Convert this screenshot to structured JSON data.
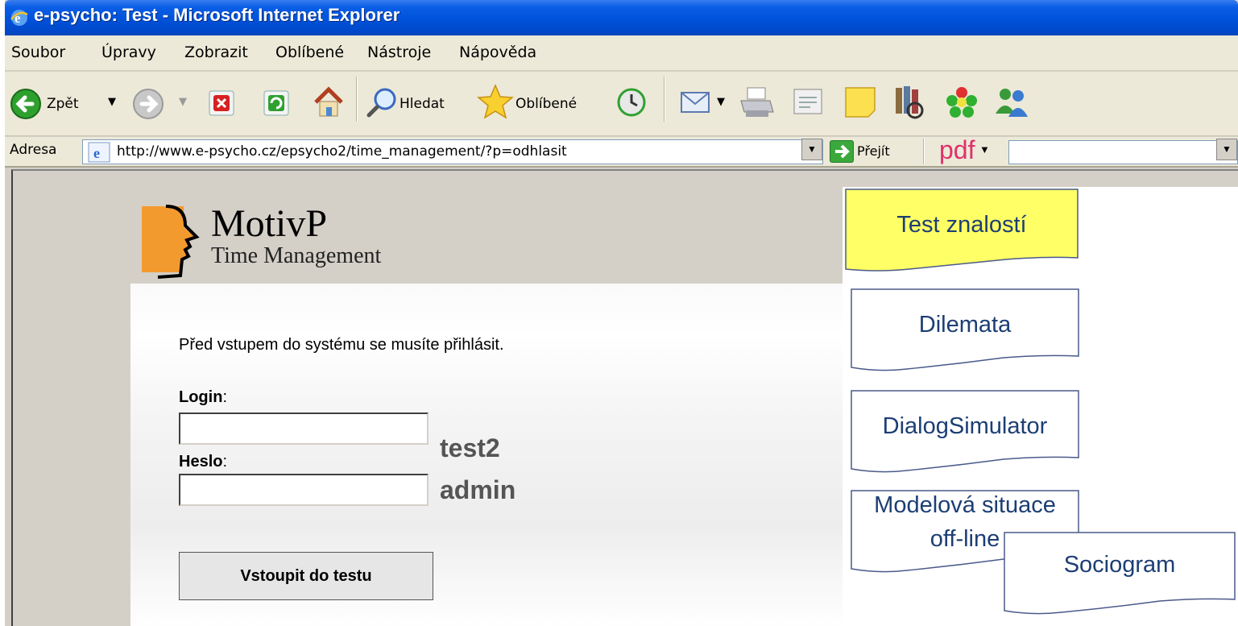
{
  "window": {
    "title": "e-psycho: Test - Microsoft Internet Explorer"
  },
  "menu": [
    "Soubor",
    "Úpravy",
    "Zobrazit",
    "Oblíbené",
    "Nástroje",
    "Nápověda"
  ],
  "toolbar": {
    "back_label": "Zpět",
    "search_label": "Hledat",
    "favorites_label": "Oblíbené"
  },
  "addressbar": {
    "label": "Adresa",
    "url": "http://www.e-psycho.cz/epsycho2/time_management/?p=odhlasit",
    "go_label": "Přejít",
    "pdf_label": "pdf"
  },
  "logo": {
    "title": "MotivP",
    "subtitle": "Time Management"
  },
  "form": {
    "intro": "Před vstupem do systému se musíte přihlásit.",
    "login_label": "Login",
    "password_label": "Heslo",
    "login_value": "",
    "password_value": "",
    "submit_label": "Vstoupit do testu"
  },
  "hints": {
    "login": "test2",
    "password": "admin"
  },
  "cards": [
    {
      "label": "Test znalostí",
      "fill": "#ffff66"
    },
    {
      "label": "Dilemata",
      "fill": "#ffffff"
    },
    {
      "label": "DialogSimulator",
      "fill": "#ffffff"
    },
    {
      "label_line1": "Modelová situace",
      "label_line2": "off-line",
      "fill": "#ffffff"
    },
    {
      "label": "Sociogram",
      "fill": "#ffffff"
    }
  ],
  "colors": {
    "titlebar": "#0050d8",
    "card_text": "#1c3e74",
    "card_border": "#4a5a8a",
    "highlight": "#ffff66"
  }
}
